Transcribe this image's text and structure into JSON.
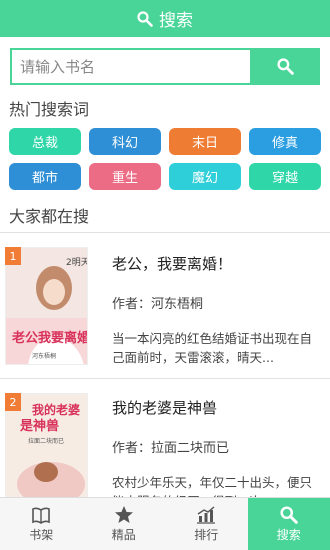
{
  "header": {
    "title": "搜索"
  },
  "search": {
    "placeholder": "请输入书名"
  },
  "hot_section": {
    "title": "热门搜索词"
  },
  "tags": [
    {
      "label": "总裁",
      "color": "#2ed6a8"
    },
    {
      "label": "科幻",
      "color": "#2f8fd6"
    },
    {
      "label": "末日",
      "color": "#ef7c33"
    },
    {
      "label": "修真",
      "color": "#2a9ee0"
    },
    {
      "label": "都市",
      "color": "#2f8fd6"
    },
    {
      "label": "重生",
      "color": "#ec6c86"
    },
    {
      "label": "魔幻",
      "color": "#2fcfd9"
    },
    {
      "label": "穿越",
      "color": "#2ed6a8"
    }
  ],
  "popular_section": {
    "title": "大家都在搜"
  },
  "books": [
    {
      "rank": "1",
      "title": "老公，我要离婚！",
      "author": "作者：河东梧桐",
      "desc": "当一本闪亮的红色结婚证书出现在自己面前时，天雷滚滚，晴天..."
    },
    {
      "rank": "2",
      "title": "我的老婆是神兽",
      "author": "作者：拉面二块而已",
      "desc": "农村少年乐天，年仅二十出头，便只能去服务的经历，得到一次..."
    }
  ],
  "tabbar": {
    "items": [
      {
        "label": "书架",
        "icon": "book-icon"
      },
      {
        "label": "精品",
        "icon": "star-icon"
      },
      {
        "label": "排行",
        "icon": "chart-icon"
      },
      {
        "label": "搜索",
        "icon": "search-icon"
      }
    ]
  },
  "colors": {
    "accent": "#48d597",
    "rank": "#f07c36"
  }
}
